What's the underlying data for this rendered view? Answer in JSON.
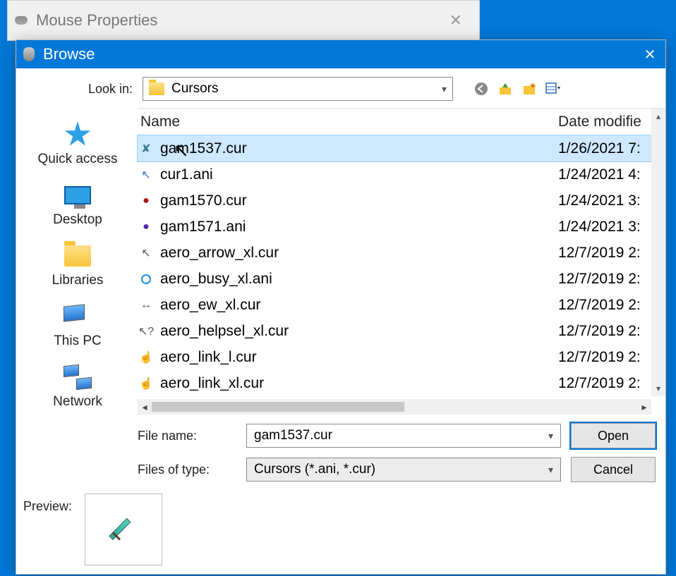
{
  "parent_window": {
    "title": "Mouse Properties"
  },
  "dialog": {
    "title": "Browse",
    "look_in_label": "Look in:",
    "look_in_value": "Cursors",
    "columns": {
      "name": "Name",
      "date": "Date modifie"
    },
    "files": [
      {
        "name": "gam1537.cur",
        "date": "1/26/2021 7:",
        "icon": "sword"
      },
      {
        "name": "cur1.ani",
        "date": "1/24/2021 4:",
        "icon": "cursor"
      },
      {
        "name": "gam1570.cur",
        "date": "1/24/2021 3:",
        "icon": "red"
      },
      {
        "name": "gam1571.ani",
        "date": "1/24/2021 3:",
        "icon": "purple"
      },
      {
        "name": "aero_arrow_xl.cur",
        "date": "12/7/2019 2:",
        "icon": "arrow"
      },
      {
        "name": "aero_busy_xl.ani",
        "date": "12/7/2019 2:",
        "icon": "busy"
      },
      {
        "name": "aero_ew_xl.cur",
        "date": "12/7/2019 2:",
        "icon": "ew"
      },
      {
        "name": "aero_helpsel_xl.cur",
        "date": "12/7/2019 2:",
        "icon": "help"
      },
      {
        "name": "aero_link_l.cur",
        "date": "12/7/2019 2:",
        "icon": "link"
      },
      {
        "name": "aero_link_xl.cur",
        "date": "12/7/2019 2:",
        "icon": "link"
      }
    ],
    "selected_index": 0,
    "sidebar": [
      {
        "label": "Quick access",
        "icon": "star"
      },
      {
        "label": "Desktop",
        "icon": "monitor"
      },
      {
        "label": "Libraries",
        "icon": "folder"
      },
      {
        "label": "This PC",
        "icon": "pc"
      },
      {
        "label": "Network",
        "icon": "net"
      }
    ],
    "file_name_label": "File name:",
    "file_name_value": "gam1537.cur",
    "files_of_type_label": "Files of type:",
    "files_of_type_value": "Cursors (*.ani, *.cur)",
    "open_label": "Open",
    "cancel_label": "Cancel",
    "preview_label": "Preview:"
  }
}
